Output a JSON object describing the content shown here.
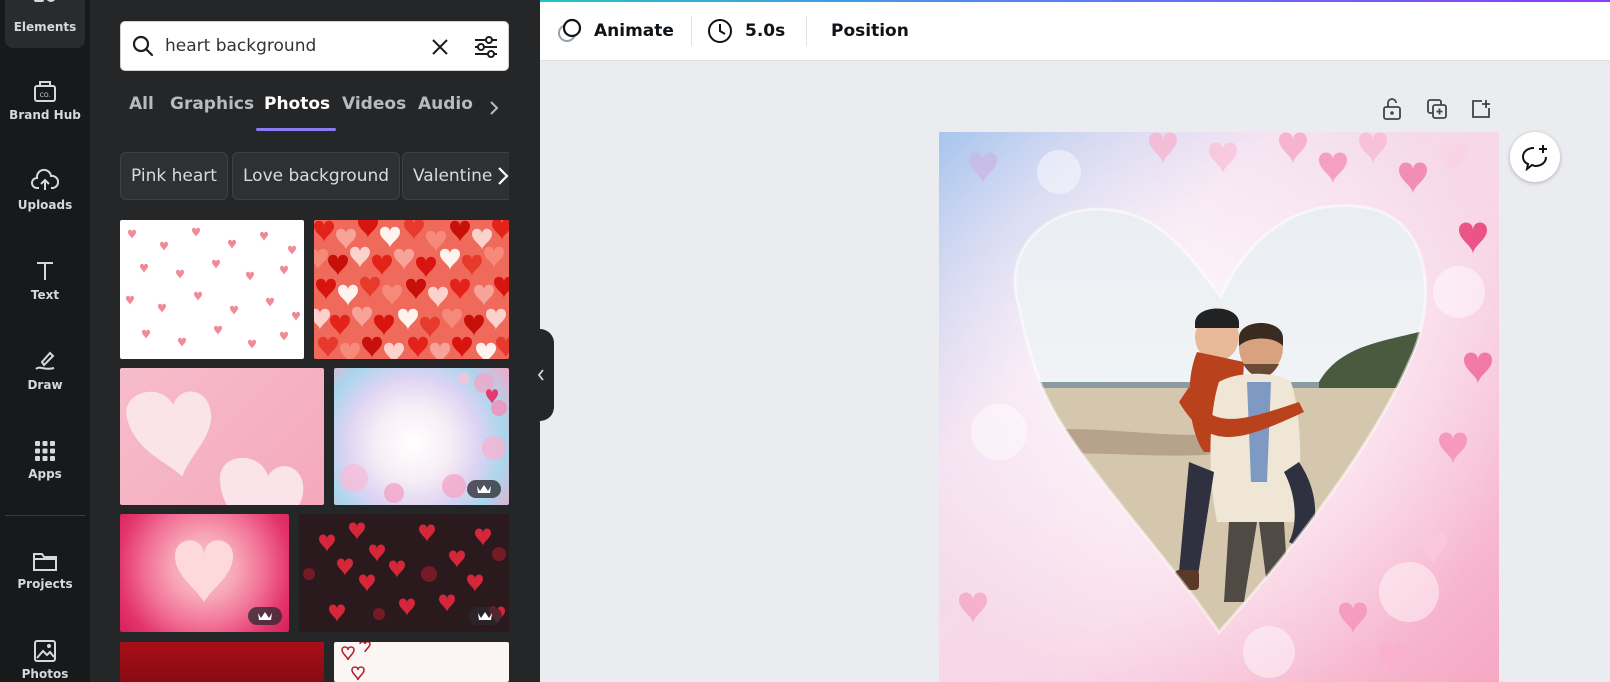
{
  "rail": {
    "items": [
      {
        "label": "Elements",
        "icon": "elements-icon"
      },
      {
        "label": "Brand Hub",
        "icon": "brand-hub-icon"
      },
      {
        "label": "Uploads",
        "icon": "upload-cloud-icon"
      },
      {
        "label": "Text",
        "icon": "text-icon"
      },
      {
        "label": "Draw",
        "icon": "draw-icon"
      },
      {
        "label": "Apps",
        "icon": "apps-grid-icon"
      },
      {
        "label": "Projects",
        "icon": "folder-icon"
      },
      {
        "label": "Photos",
        "icon": "photo-icon"
      }
    ]
  },
  "search": {
    "value": "heart background",
    "placeholder": ""
  },
  "tabs": [
    {
      "label": "All"
    },
    {
      "label": "Graphics"
    },
    {
      "label": "Photos",
      "active": true
    },
    {
      "label": "Videos"
    },
    {
      "label": "Audio"
    }
  ],
  "chips": [
    {
      "label": "Pink heart"
    },
    {
      "label": "Love background"
    },
    {
      "label": "Valentine"
    }
  ],
  "results": [
    {
      "name": "small pink hearts on white",
      "premium": false
    },
    {
      "name": "red hearts pattern",
      "premium": false
    },
    {
      "name": "pink paper hearts",
      "premium": false
    },
    {
      "name": "bokeh hearts pastel",
      "premium": true
    },
    {
      "name": "concentric pink heart",
      "premium": true
    },
    {
      "name": "red bokeh hearts on dark",
      "premium": true
    },
    {
      "name": "dark red background",
      "premium": false
    },
    {
      "name": "hand drawn red hearts",
      "premium": false
    }
  ],
  "toolbar": {
    "animate_label": "Animate",
    "duration_label": "5.0s",
    "position_label": "Position"
  },
  "colors": {
    "accent": "#8b7cf6",
    "rail_bg": "#18191b",
    "panel_bg": "#252627",
    "canvas_bg": "#ebecf0"
  }
}
